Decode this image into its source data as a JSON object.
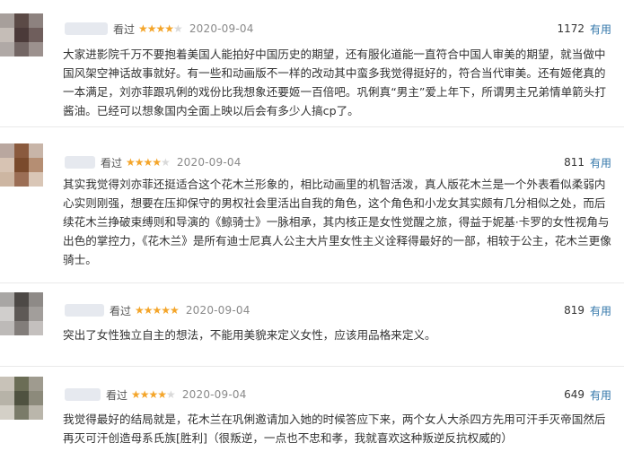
{
  "reviews": [
    {
      "watched_label": "看过",
      "rating": 4,
      "date": "2020-09-04",
      "votes": "1172",
      "useful_label": "有用",
      "content": "大家进影院千万不要抱着美国人能拍好中国历史的期望，还有服化道能一直符合中国人审美的期望，就当做中国风架空神话故事就好。有一些和动画版不一样的改动其中蛮多我觉得挺好的，符合当代审美。还有姬佬真的一本满足，刘亦菲跟巩俐的戏份比我想象还要姬一百倍吧。巩俐真“男主”爱上年下，所谓男主兄弟情单箭头打酱油。已经可以想象国内全面上映以后会有多少人搞cp了。"
    },
    {
      "watched_label": "看过",
      "rating": 4,
      "date": "2020-09-04",
      "votes": "811",
      "useful_label": "有用",
      "content": "其实我觉得刘亦菲还挺适合这个花木兰形象的，相比动画里的机智活泼，真人版花木兰是一个外表看似柔弱内心实则刚强，想要在压抑保守的男权社会里活出自我的角色，这个角色和小龙女其实颇有几分相似之处，而后续花木兰挣破束缚则和导演的《鲸骑士》一脉相承，其内核正是女性觉醒之旅，得益于妮基·卡罗的女性视角与出色的掌控力，《花木兰》是所有迪士尼真人公主大片里女性主义诠释得最好的一部，相较于公主，花木兰更像骑士。"
    },
    {
      "watched_label": "看过",
      "rating": 5,
      "date": "2020-09-04",
      "votes": "819",
      "useful_label": "有用",
      "content": "突出了女性独立自主的想法，不能用美貌来定义女性，应该用品格来定义。"
    },
    {
      "watched_label": "看过",
      "rating": 4,
      "date": "2020-09-04",
      "votes": "649",
      "useful_label": "有用",
      "content": "我觉得最好的结局就是，花木兰在巩俐邀请加入她的时候答应下来，两个女人大杀四方先用可汗手灭帝国然后再灭可汗创造母系氏族[胜利]（很叛逆，一点也不忠和孝，我就喜欢这种叛逆反抗权威的）"
    }
  ]
}
